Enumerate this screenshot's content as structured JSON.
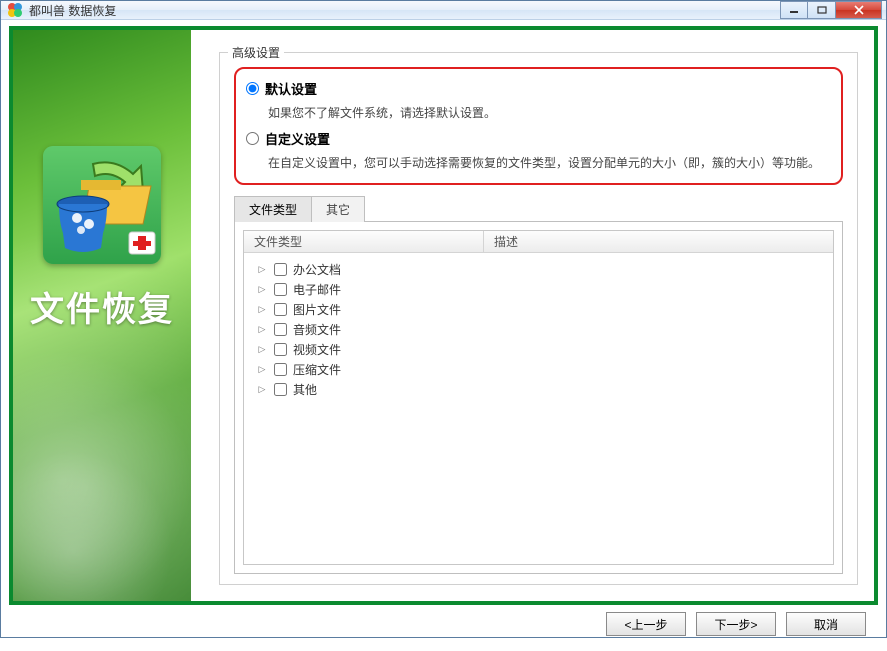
{
  "window": {
    "title": "都叫兽 数据恢复"
  },
  "sidebar": {
    "title": "文件恢复"
  },
  "fieldset": {
    "legend": "高级设置"
  },
  "options": {
    "default_label": "默认设置",
    "default_desc": "如果您不了解文件系统，请选择默认设置。",
    "custom_label": "自定义设置",
    "custom_desc": "在自定义设置中，您可以手动选择需要恢复的文件类型，设置分配单元的大小（即，簇的大小）等功能。",
    "selected": "default"
  },
  "tabs": [
    {
      "id": "filetype",
      "label": "文件类型",
      "active": true
    },
    {
      "id": "other",
      "label": "其它",
      "active": false
    }
  ],
  "table": {
    "col_a": "文件类型",
    "col_b": "描述",
    "rows": [
      {
        "label": "办公文档"
      },
      {
        "label": "电子邮件"
      },
      {
        "label": "图片文件"
      },
      {
        "label": "音频文件"
      },
      {
        "label": "视频文件"
      },
      {
        "label": "压缩文件"
      },
      {
        "label": "其他"
      }
    ]
  },
  "footer": {
    "prev": "<上一步",
    "next": "下一步>",
    "cancel": "取消"
  }
}
